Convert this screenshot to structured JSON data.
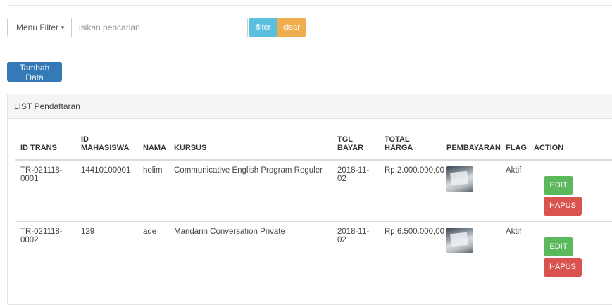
{
  "filter": {
    "menu_label": "Menu Filter",
    "search_placeholder": "isikan pencarian",
    "search_value": "",
    "filter_label": "filter",
    "clear_label": "clear"
  },
  "add_button_label": "Tambah Data",
  "panel": {
    "title": "LIST Pendaftaran",
    "columns": [
      "ID TRANS",
      "ID MAHASISWA",
      "NAMA",
      "KURSUS",
      "TGL BAYAR",
      "TOTAL HARGA",
      "PEMBAYARAN",
      "FLAG",
      "ACTION"
    ],
    "rows": [
      {
        "id_trans": "TR-021118-0001",
        "id_mahasiswa": "14410100001",
        "nama": "holim",
        "kursus": "Communicative English Program Reguler",
        "tgl_bayar": "2018-11-02",
        "total_harga": "Rp.2.000.000,00",
        "flag": "Aktif",
        "edit_label": "EDIT",
        "hapus_label": "HAPUS"
      },
      {
        "id_trans": "TR-021118-0002",
        "id_mahasiswa": "129",
        "nama": "ade",
        "kursus": "Mandarin Conversation Private",
        "tgl_bayar": "2018-11-02",
        "total_harga": "Rp.6.500.000,00",
        "flag": "Aktif",
        "edit_label": "EDIT",
        "hapus_label": "HAPUS"
      }
    ]
  },
  "colors": {
    "primary": "#337ab7",
    "info": "#5bc0de",
    "warning": "#f0ad4e",
    "success": "#5cb85c",
    "danger": "#d9534f"
  }
}
